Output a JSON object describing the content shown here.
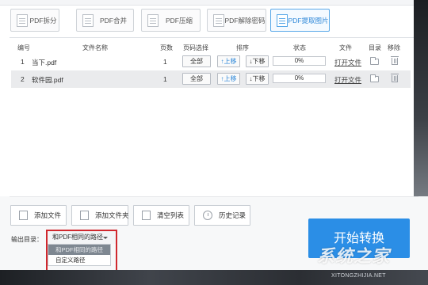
{
  "toolbar": {
    "tabs": [
      {
        "label": "PDF拆分"
      },
      {
        "label": "PDF合并"
      },
      {
        "label": "PDF压缩"
      },
      {
        "label": "PDF解除密码"
      },
      {
        "label": "PDF提取图片",
        "active": true
      }
    ]
  },
  "table": {
    "headers": {
      "index": "编号",
      "name": "文件名称",
      "pages": "页数",
      "page_select": "页码选择",
      "sort": "排序",
      "status": "状态",
      "file": "文件",
      "dir": "目录",
      "remove": "移除"
    },
    "rows": [
      {
        "index": "1",
        "name": "当下.pdf",
        "pages": "1",
        "page_btn": "全部",
        "up": "↑上移",
        "down": "↓下移",
        "progress": "0%",
        "open": "打开文件"
      },
      {
        "index": "2",
        "name": "软件园.pdf",
        "pages": "1",
        "page_btn": "全部",
        "up": "↑上移",
        "down": "↓下移",
        "progress": "0%",
        "open": "打开文件"
      }
    ]
  },
  "actions": {
    "add_file": "添加文件",
    "add_folder": "添加文件夹",
    "clear_list": "清空列表",
    "history": "历史记录"
  },
  "output": {
    "label": "输出目录：",
    "selected": "和PDF相同的路径",
    "options": [
      "和PDF相同的路径",
      "自定义路径"
    ]
  },
  "start_button": "开始转换",
  "watermark": {
    "logo": "系统之家",
    "url": "XITONGZHIJIA.NET"
  },
  "colors": {
    "accent": "#2b8ee6",
    "highlight": "#d0282e"
  }
}
